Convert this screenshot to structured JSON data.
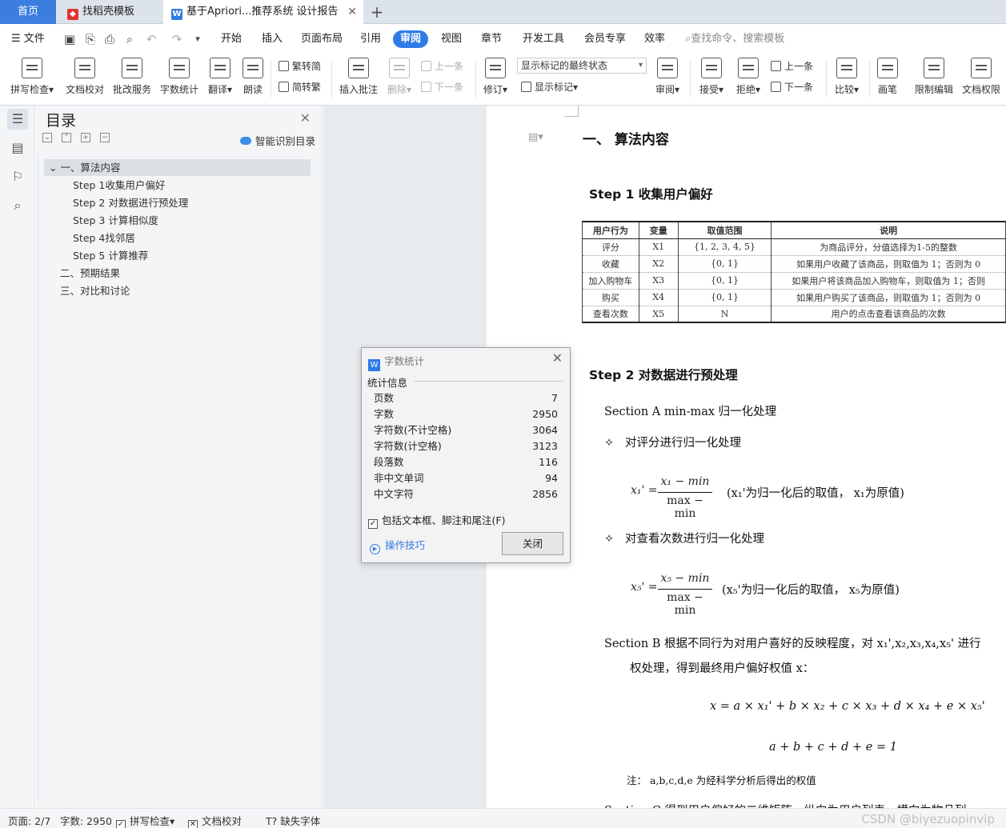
{
  "tabs": [
    {
      "label": "首页"
    },
    {
      "label": "找稻壳模板"
    },
    {
      "label": "基于Apriori...推荐系统 设计报告"
    }
  ],
  "menu": {
    "file": "文件",
    "items": [
      "开始",
      "插入",
      "页面布局",
      "引用",
      "审阅",
      "视图",
      "章节",
      "开发工具",
      "会员专享",
      "效率"
    ],
    "active": "审阅",
    "search_placeholder": "查找命令、搜索模板"
  },
  "toolbar": {
    "spell": "拼写检查",
    "proof": "文档校对",
    "correct": "批改服务",
    "wordcount": "字数统计",
    "translate": "翻译",
    "read": "朗读",
    "trad": "繁转简",
    "simp": "简转繁",
    "insert_comment": "插入批注",
    "delete": "删除",
    "prev": "上一条",
    "next": "下一条",
    "revise": "修订",
    "markup_state": "显示标记的最终状态",
    "show_markup": "显示标记",
    "review": "审阅",
    "accept": "接受",
    "reject": "拒绝",
    "prev2": "上一条",
    "next2": "下一条",
    "compare": "比较",
    "pen": "画笔",
    "restrict": "限制编辑",
    "perm": "文档权限"
  },
  "toc": {
    "title": "目录",
    "smart": "智能识别目录",
    "items": [
      "一、算法内容",
      "Step 1收集用户偏好",
      "Step 2  对数据进行预处理",
      "Step 3  计算相似度",
      "Step 4找邻居",
      "Step 5  计算推荐",
      "二、预期结果",
      "三、对比和讨论"
    ]
  },
  "doc": {
    "h1": "一、   算法内容",
    "step1": "Step 1     收集用户偏好",
    "table": {
      "headers": [
        "用户行为",
        "变量",
        "取值范围",
        "说明"
      ],
      "rows": [
        [
          "评分",
          "X1",
          "{1, 2, 3, 4, 5}",
          "为商品评分，分值选择为1-5的整数"
        ],
        [
          "收藏",
          "X2",
          "{0, 1}",
          "如果用户收藏了该商品，则取值为 1；否则为 0"
        ],
        [
          "加入购物车",
          "X3",
          "{0, 1}",
          "如果用户将该商品加入购物车，则取值为 1；否则"
        ],
        [
          "购买",
          "X4",
          "{0, 1}",
          "如果用户购买了该商品，则取值为 1；否则为 0"
        ],
        [
          "查看次数",
          "X5",
          "N",
          "用户的点击查看该商品的次数"
        ]
      ]
    },
    "step2": "Step 2     对数据进行预处理",
    "secA": "Section A   min-max 归一化处理",
    "b1": "对评分进行归一化处理",
    "f1_lhs": "x₁' =",
    "f1_num": "x₁ − min",
    "f1_den": "max − min",
    "f1_note": "(x₁'为归一化后的取值， x₁为原值)",
    "b2": "对查看次数进行归一化处理",
    "f2_lhs": "x₅' =",
    "f2_num": "x₅ − min",
    "f2_den": "max − min",
    "f2_note": "(x₅'为归一化后的取值， x₅为原值)",
    "secB": "Section B    根据不同行为对用户喜好的反映程度，对 x₁',x₂,x₃,x₄,x₅' 进行",
    "secB2": "权处理，得到最终用户偏好权值 x：",
    "f3": "x = a × x₁' + b × x₂ + c × x₃ + d × x₄ + e × x₅'",
    "f4": "a + b + c + d + e = 1",
    "note": "注：  a,b,c,d,e 为经科学分析后得出的权值",
    "secC": "Section C    得到用户偏好的二维矩阵，纵向为用户列表，横向为物品列"
  },
  "dialog": {
    "title": "字数统计",
    "section": "统计信息",
    "rows": [
      {
        "label": "页数",
        "value": "7"
      },
      {
        "label": "字数",
        "value": "2950"
      },
      {
        "label": "字符数(不计空格)",
        "value": "3064"
      },
      {
        "label": "字符数(计空格)",
        "value": "3123"
      },
      {
        "label": "段落数",
        "value": "116"
      },
      {
        "label": "非中文单词",
        "value": "94"
      },
      {
        "label": "中文字符",
        "value": "2856"
      }
    ],
    "checkbox": "包括文本框、脚注和尾注(F)",
    "tips": "操作技巧",
    "close": "关闭"
  },
  "status": {
    "page": "页面: 2/7",
    "words": "字数: 2950",
    "spell": "拼写检查",
    "proof": "文档校对",
    "font": "缺失字体",
    "watermark": "CSDN @biyezuopinvip"
  },
  "colors": {
    "accent": "#2f7be6",
    "home_tab": "#3b7ee0"
  }
}
